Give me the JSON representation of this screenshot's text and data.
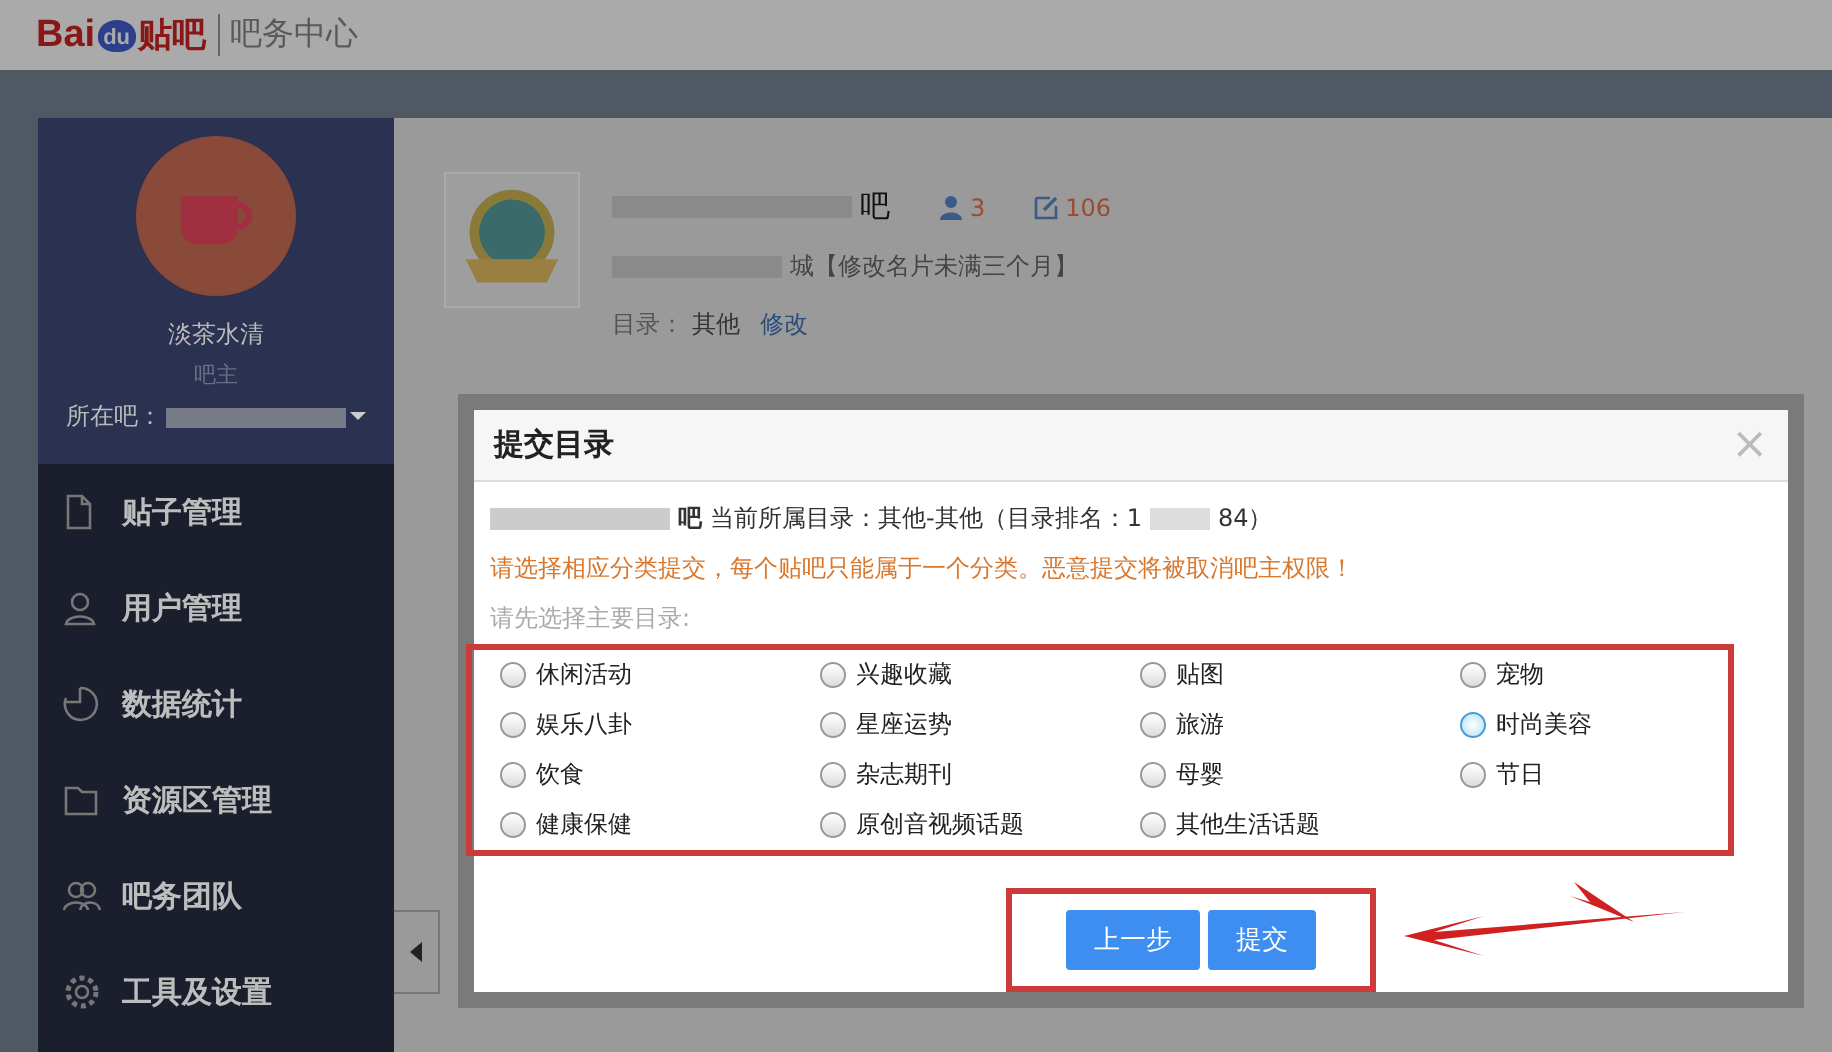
{
  "header": {
    "logo_bai": "Bai",
    "logo_du": "du",
    "logo_tieba": "贴吧",
    "title": "吧务中心"
  },
  "sidebar": {
    "username": "淡茶水清",
    "role": "吧主",
    "forum_label": "所在吧：",
    "items": [
      {
        "label": "贴子管理",
        "kind": "posts"
      },
      {
        "label": "用户管理",
        "kind": "users"
      },
      {
        "label": "数据统计",
        "kind": "stats"
      },
      {
        "label": "资源区管理",
        "kind": "folder"
      },
      {
        "label": "吧务团队",
        "kind": "team"
      },
      {
        "label": "工具及设置",
        "kind": "settings"
      }
    ]
  },
  "forum": {
    "name_end": "吧",
    "members": "3",
    "posts": "106",
    "card_end": "城【修改名片未满三个月】",
    "catalog_label": "目录：",
    "catalog_value": "其他",
    "edit_link": "修改"
  },
  "dialog": {
    "title": "提交目录",
    "close": "×",
    "info_name_end": "吧",
    "info": "当前所属目录：其他-其他（目录排名：1",
    "info_end": "84）",
    "warning": "请选择相应分类提交，每个贴吧只能属于一个分类。恶意提交将被取消吧主权限！",
    "prompt": "请先选择主要目录:",
    "options": [
      {
        "label": "休闲活动",
        "selected": false
      },
      {
        "label": "兴趣收藏",
        "selected": false
      },
      {
        "label": "贴图",
        "selected": false
      },
      {
        "label": "宠物",
        "selected": false
      },
      {
        "label": "娱乐八卦",
        "selected": false
      },
      {
        "label": "星座运势",
        "selected": false
      },
      {
        "label": "旅游",
        "selected": false
      },
      {
        "label": "时尚美容",
        "selected": true
      },
      {
        "label": "饮食",
        "selected": false
      },
      {
        "label": "杂志期刊",
        "selected": false
      },
      {
        "label": "母婴",
        "selected": false
      },
      {
        "label": "节日",
        "selected": false
      },
      {
        "label": "健康保健",
        "selected": false
      },
      {
        "label": "原创音视频话题",
        "selected": false
      },
      {
        "label": "其他生活话题",
        "selected": false
      }
    ],
    "buttons": [
      "上一步",
      "提交"
    ]
  }
}
